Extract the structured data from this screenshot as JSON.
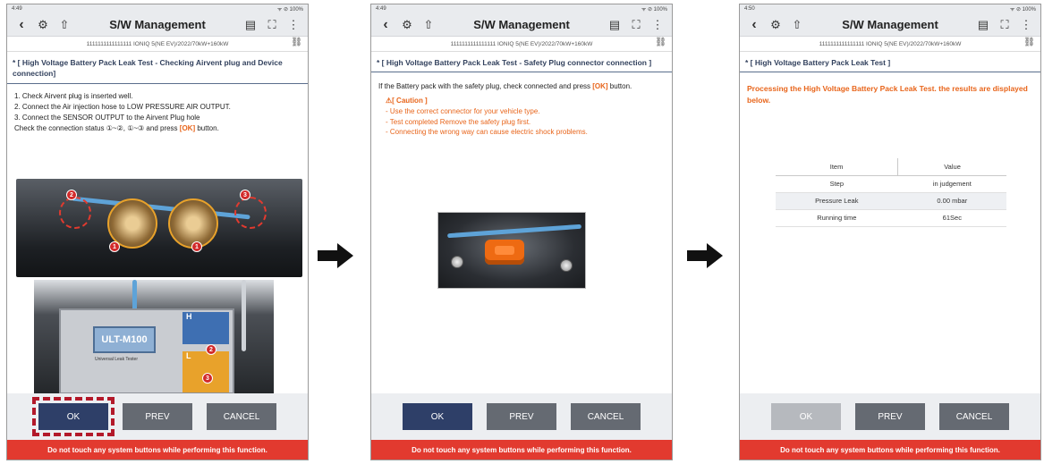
{
  "common": {
    "app_title": "S/W Management",
    "vehicle_info": "1111111111111111  IONIQ 5(NE EV)/2022/70kW+160kW",
    "warning": "Do not touch any system buttons while performing this function.",
    "buttons": {
      "ok": "OK",
      "prev": "PREV",
      "cancel": "CANCEL"
    },
    "icons": {
      "back": "back-arrow-icon",
      "diag": "vehicle-diag-icon",
      "update": "sw-update-icon",
      "record": "record-icon",
      "capture": "screen-capture-icon",
      "more": "more-vertical-icon",
      "car": "car-settings-icon"
    }
  },
  "screens": [
    {
      "status_time": "4:49",
      "status_right": "ᯤ ⊘ 100%",
      "section_title": "* [ High Voltage Battery Pack Leak Test - Checking Airvent plug and Device connection]",
      "steps": [
        "1. Check Airvent plug is inserted well.",
        "2. Connect the Air injection hose to LOW PRESSURE AIR OUTPUT.",
        "3. Connect the SENSOR OUTPUT to the Airvent Plug hole"
      ],
      "check_prefix": "Check the connection status ①~②, ①~③ and press ",
      "check_ok": "[OK]",
      "check_suffix": " button.",
      "image": {
        "device_model": "ULT-M100",
        "device_sub": "Universal Leak Tester",
        "label_h": "H",
        "label_l": "L",
        "badges": [
          "2",
          "1",
          "1",
          "3",
          "2",
          "3"
        ]
      }
    },
    {
      "status_time": "4:49",
      "status_right": "ᯤ ⊘ 100%",
      "section_title": "* [ High Voltage Battery Pack Leak Test - Safety Plug connector connection ]",
      "instruction_prefix": "If the Battery pack with the safety plug, check connected and press ",
      "instruction_ok": "[OK]",
      "instruction_suffix": " button.",
      "caution_title": "[ Caution ]",
      "caution_items": [
        "- Use the correct connector for your vehicle type.",
        "- Test completed Remove the safety plug first.",
        "- Connecting the wrong way can cause electric shock problems."
      ]
    },
    {
      "status_time": "4:50",
      "status_right": "ᯤ ⊘ 100%",
      "section_title": "* [ High Voltage Battery Pack Leak Test ]",
      "message": "Processing the High Voltage Battery Pack Leak Test. the results are displayed below.",
      "table": {
        "headers": [
          "Item",
          "Value"
        ],
        "rows": [
          [
            "Step",
            "in judgement"
          ],
          [
            "Pressure Leak",
            "0.00 mbar"
          ],
          [
            "Running time",
            "61Sec"
          ]
        ]
      }
    }
  ],
  "colors": {
    "accent": "#e8651b",
    "ok_button": "#2e3f68",
    "warning_bar": "#e23a2f",
    "highlight": "#b3192a"
  }
}
